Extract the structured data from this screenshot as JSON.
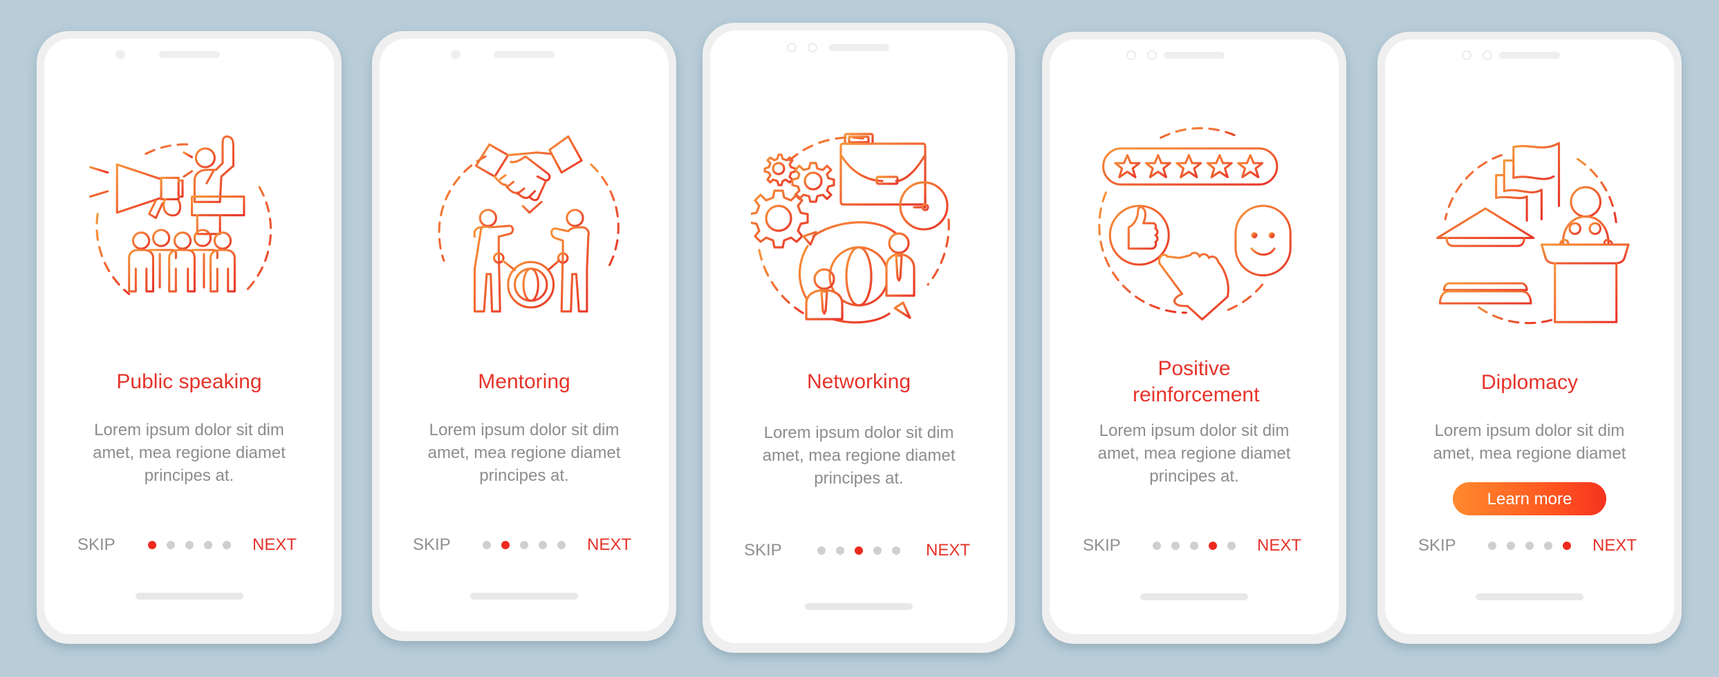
{
  "colors": {
    "background": "#b8cdd8",
    "accent": "#e5332a",
    "active_dot": "#ee2a1e",
    "inactive_dot": "#cfcfcf",
    "body_text": "#8d8d8d",
    "gradient_start": "#f7943a",
    "gradient_end": "#e8352a"
  },
  "screens": [
    {
      "illustration": "public-speaking-icon",
      "title": "Public speaking",
      "description": "Lorem ipsum dolor sit dim amet, mea regione diamet principes at.",
      "skip_label": "SKIP",
      "next_label": "NEXT",
      "active_page": 1,
      "total_pages": 5
    },
    {
      "illustration": "mentoring-icon",
      "title": "Mentoring",
      "description": "Lorem ipsum dolor sit dim amet, mea regione diamet principes at.",
      "skip_label": "SKIP",
      "next_label": "NEXT",
      "active_page": 2,
      "total_pages": 5
    },
    {
      "illustration": "networking-icon",
      "title": "Networking",
      "description": "Lorem ipsum dolor sit dim amet, mea regione diamet principes at.",
      "skip_label": "SKIP",
      "next_label": "NEXT",
      "active_page": 3,
      "total_pages": 5
    },
    {
      "illustration": "positive-reinforcement-icon",
      "title": "Positive reinforcement",
      "description": "Lorem ipsum dolor sit dim amet, mea regione diamet principes at.",
      "skip_label": "SKIP",
      "next_label": "NEXT",
      "active_page": 4,
      "total_pages": 5
    },
    {
      "illustration": "diplomacy-icon",
      "title": "Diplomacy",
      "description": "Lorem ipsum dolor sit dim amet, mea regione diamet",
      "cta_label": "Learn more",
      "skip_label": "SKIP",
      "next_label": "NEXT",
      "active_page": 5,
      "total_pages": 5
    }
  ]
}
